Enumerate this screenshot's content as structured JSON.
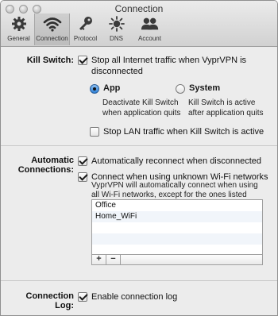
{
  "window": {
    "title": "Connection"
  },
  "toolbar": {
    "items": [
      {
        "label": "General",
        "icon": "gear-icon"
      },
      {
        "label": "Connection",
        "icon": "wifi-icon",
        "active": true
      },
      {
        "label": "Protocol",
        "icon": "key-icon"
      },
      {
        "label": "DNS",
        "icon": "sun-dns-icon"
      },
      {
        "label": "Account",
        "icon": "users-icon"
      }
    ]
  },
  "kill_switch": {
    "section_label": "Kill Switch:",
    "stop_all": {
      "label": "Stop all Internet traffic when VyprVPN is disconnected",
      "checked": true
    },
    "mode": {
      "app": {
        "title": "App",
        "desc": "Deactivate Kill Switch when application quits",
        "selected": true
      },
      "system": {
        "title": "System",
        "desc": "Kill Switch is active after application quits",
        "selected": false
      }
    },
    "stop_lan": {
      "label": "Stop LAN traffic when Kill Switch is active",
      "checked": false
    }
  },
  "automatic": {
    "section_label": "Automatic Connections:",
    "reconnect": {
      "label": "Automatically reconnect when disconnected",
      "checked": true
    },
    "unknown_wifi": {
      "label": "Connect when using unknown Wi-Fi networks",
      "checked": true,
      "desc": "VyprVPN will automatically connect when using all Wi-Fi networks, except for the ones listed below."
    },
    "networks": [
      "Office",
      "Home_WiFi"
    ],
    "add_label": "+",
    "remove_label": "−"
  },
  "log": {
    "section_label": "Connection Log:",
    "enable": {
      "label": "Enable connection log",
      "checked": true
    }
  },
  "colors": {
    "selected_radio": "#2c7fd6",
    "window_bg": "#ececec"
  }
}
